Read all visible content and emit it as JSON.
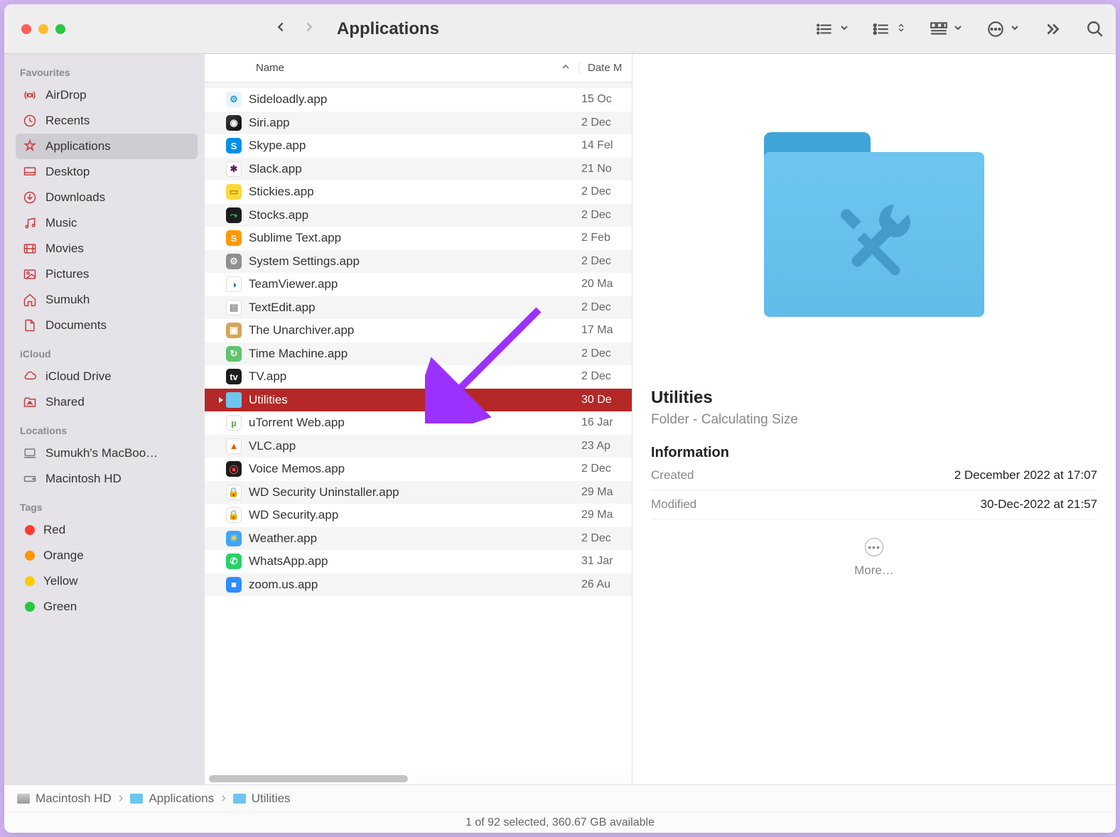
{
  "window": {
    "title": "Applications"
  },
  "sidebar": {
    "sections": [
      {
        "title": "Favourites",
        "items": [
          {
            "label": "AirDrop",
            "icon": "airdrop"
          },
          {
            "label": "Recents",
            "icon": "clock"
          },
          {
            "label": "Applications",
            "icon": "apps",
            "active": true
          },
          {
            "label": "Desktop",
            "icon": "desktop"
          },
          {
            "label": "Downloads",
            "icon": "download"
          },
          {
            "label": "Music",
            "icon": "music"
          },
          {
            "label": "Movies",
            "icon": "movies"
          },
          {
            "label": "Pictures",
            "icon": "pictures"
          },
          {
            "label": "Sumukh",
            "icon": "home"
          },
          {
            "label": "Documents",
            "icon": "doc"
          }
        ]
      },
      {
        "title": "iCloud",
        "items": [
          {
            "label": "iCloud Drive",
            "icon": "cloud"
          },
          {
            "label": "Shared",
            "icon": "shared"
          }
        ]
      },
      {
        "title": "Locations",
        "items": [
          {
            "label": "Sumukh's MacBoo…",
            "icon": "laptop",
            "gray": true
          },
          {
            "label": "Macintosh HD",
            "icon": "hd",
            "gray": true
          }
        ]
      },
      {
        "title": "Tags",
        "items": [
          {
            "label": "Red",
            "color": "#ff3b30"
          },
          {
            "label": "Orange",
            "color": "#ff9500"
          },
          {
            "label": "Yellow",
            "color": "#ffcc00"
          },
          {
            "label": "Green",
            "color": "#28c840"
          }
        ]
      }
    ]
  },
  "columns": {
    "name": "Name",
    "date": "Date M"
  },
  "files": [
    {
      "name": "Sideloadly.app",
      "date": "15 Oc",
      "bg": "#e8f4fb",
      "fg": "#2b9ad4",
      "g": "⚙"
    },
    {
      "name": "Siri.app",
      "date": "2 Dec",
      "bg": "linear-gradient(135deg,#3a3a3a,#0a0a0a)",
      "fg": "#fff",
      "g": "◉"
    },
    {
      "name": "Skype.app",
      "date": "14 Fel",
      "bg": "#0090e8",
      "fg": "#fff",
      "g": "S"
    },
    {
      "name": "Slack.app",
      "date": "21 No",
      "bg": "#fff",
      "fg": "#611f69",
      "g": "✱"
    },
    {
      "name": "Stickies.app",
      "date": "2 Dec",
      "bg": "#ffd93b",
      "fg": "#b58900",
      "g": "▭"
    },
    {
      "name": "Stocks.app",
      "date": "2 Dec",
      "bg": "#1c1c1e",
      "fg": "#34c759",
      "g": "⤳"
    },
    {
      "name": "Sublime Text.app",
      "date": "2 Feb",
      "bg": "#ff9800",
      "fg": "#fff",
      "g": "S"
    },
    {
      "name": "System Settings.app",
      "date": "2 Dec",
      "bg": "#8e8e93",
      "fg": "#eee",
      "g": "⚙"
    },
    {
      "name": "TeamViewer.app",
      "date": "20 Ma",
      "bg": "#fff",
      "fg": "#0a6dc9",
      "g": "◑"
    },
    {
      "name": "TextEdit.app",
      "date": "2 Dec",
      "bg": "#fff",
      "fg": "#888",
      "g": "▤"
    },
    {
      "name": "The Unarchiver.app",
      "date": "17 Ma",
      "bg": "#d4a556",
      "fg": "#fff",
      "g": "▣"
    },
    {
      "name": "Time Machine.app",
      "date": "2 Dec",
      "bg": "#60c56e",
      "fg": "#fff",
      "g": "↻"
    },
    {
      "name": "TV.app",
      "date": "2 Dec",
      "bg": "#1c1c1e",
      "fg": "#fff",
      "g": "tv"
    },
    {
      "name": "Utilities",
      "date": "30 De",
      "folder": true,
      "selected": true
    },
    {
      "name": "uTorrent Web.app",
      "date": "16 Jar",
      "bg": "#fff",
      "fg": "#52b043",
      "g": "µ"
    },
    {
      "name": "VLC.app",
      "date": "23 Ap",
      "bg": "#fff",
      "fg": "#e85e00",
      "g": "▲"
    },
    {
      "name": "Voice Memos.app",
      "date": "2 Dec",
      "bg": "#1c1c1e",
      "fg": "#ff453a",
      "g": "⦿"
    },
    {
      "name": "WD Security Uninstaller.app",
      "date": "29 Ma",
      "bg": "#fff",
      "fg": "#0a6dc9",
      "g": "🔒"
    },
    {
      "name": "WD Security.app",
      "date": "29 Ma",
      "bg": "#fff",
      "fg": "#0a6dc9",
      "g": "🔒"
    },
    {
      "name": "Weather.app",
      "date": "2 Dec",
      "bg": "#3fa5f5",
      "fg": "#ffd93b",
      "g": "☀"
    },
    {
      "name": "WhatsApp.app",
      "date": "31 Jar",
      "bg": "#25d366",
      "fg": "#fff",
      "g": "✆"
    },
    {
      "name": "zoom.us.app",
      "date": "26 Au",
      "bg": "#2d8cff",
      "fg": "#fff",
      "g": "■"
    }
  ],
  "preview": {
    "title": "Utilities",
    "subtitle": "Folder - Calculating Size",
    "info_head": "Information",
    "created_k": "Created",
    "created_v": "2 December 2022 at 17:07",
    "modified_k": "Modified",
    "modified_v": "30-Dec-2022 at 21:57",
    "more": "More…"
  },
  "path": [
    {
      "label": "Macintosh HD",
      "type": "hd"
    },
    {
      "label": "Applications",
      "type": "folder"
    },
    {
      "label": "Utilities",
      "type": "folder"
    }
  ],
  "status": "1 of 92 selected, 360.67 GB available"
}
